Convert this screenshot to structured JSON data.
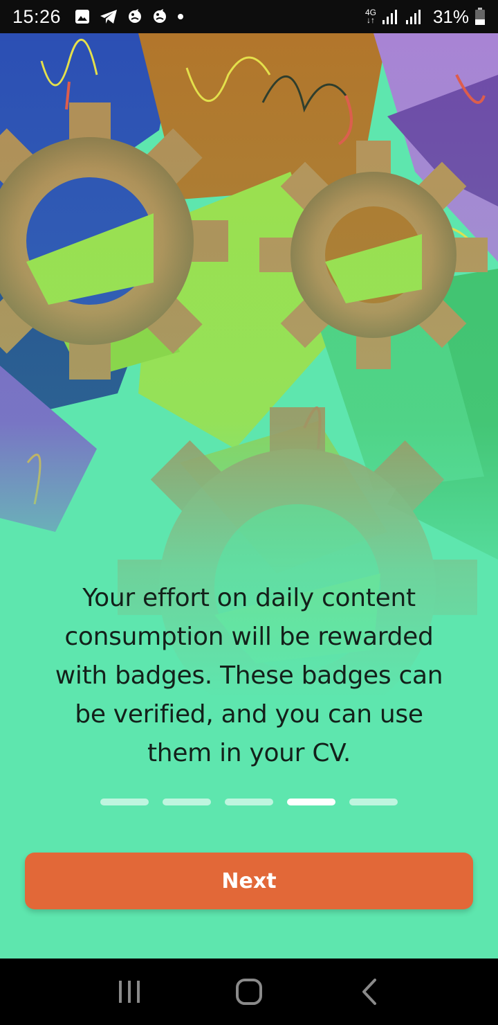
{
  "status_bar": {
    "time": "15:26",
    "left_icons": [
      "gallery-icon",
      "telegram-icon",
      "premier-league-icon",
      "premier-league-icon",
      "notification-dot-icon"
    ],
    "network_label_top": "4G",
    "network_label_bottom": "↓↑",
    "battery": "31%"
  },
  "onboarding": {
    "message": "Your effort on daily content\nconsumption will be rewarded\nwith  badges. These badges can\nbe verified, and you can use\nthem in your CV.",
    "page_count": 5,
    "active_page": 4,
    "next_label": "Next"
  },
  "colors": {
    "background": "#5ee6ae",
    "button": "#e26838",
    "text": "#13201a"
  },
  "nav_bar": {
    "buttons": [
      "recent-apps-icon",
      "home-icon",
      "back-icon"
    ]
  }
}
